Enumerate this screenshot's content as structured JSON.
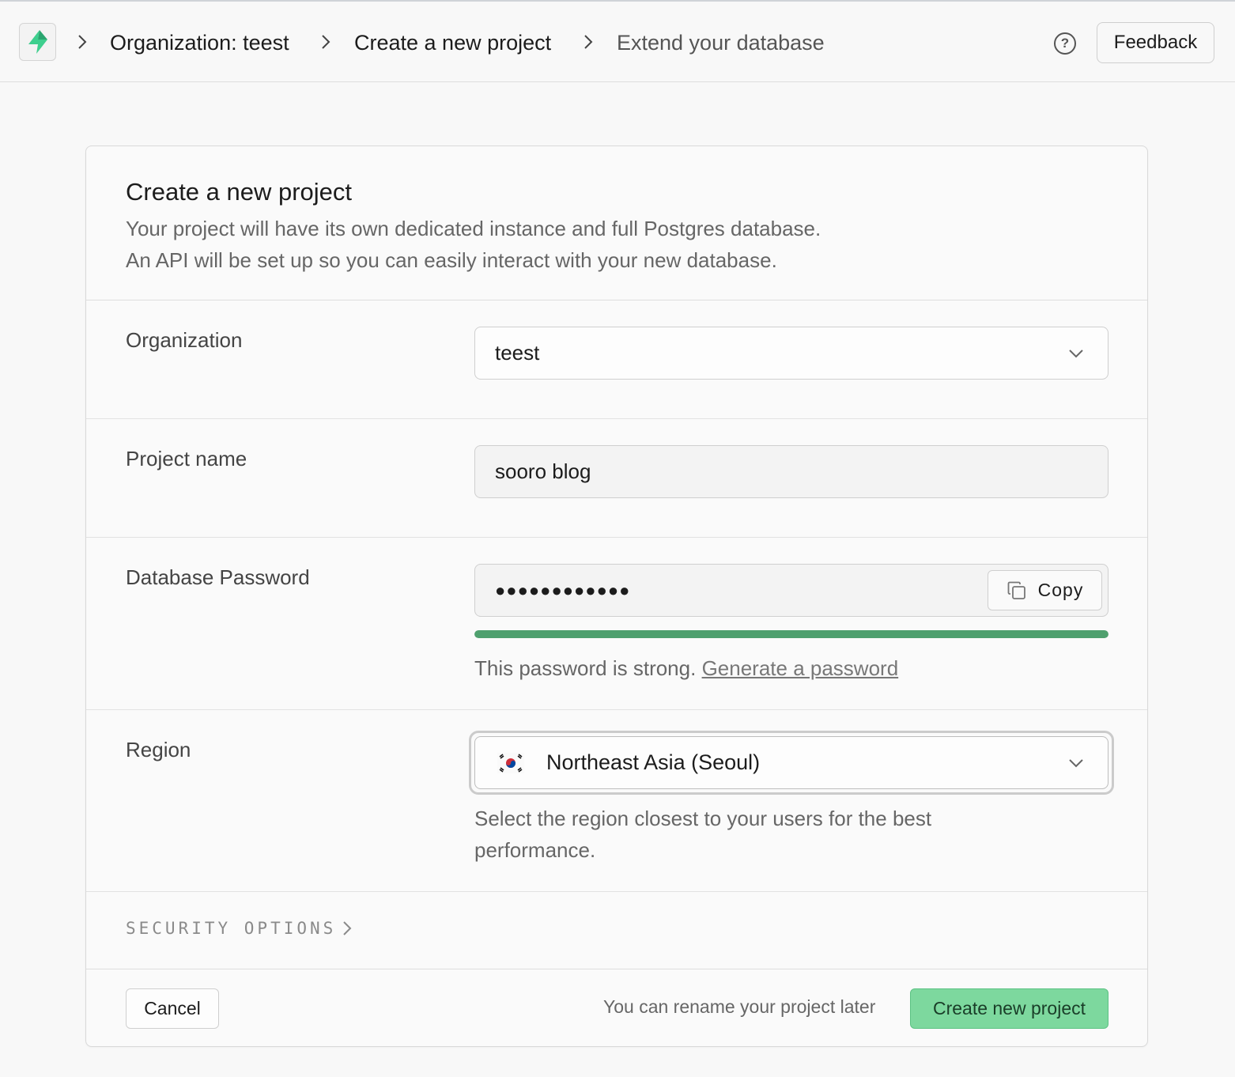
{
  "header": {
    "breadcrumbs": [
      "Organization: teest",
      "Create a new project",
      "Extend your database"
    ],
    "help_icon": "help-circle-icon",
    "feedback_label": "Feedback"
  },
  "card": {
    "title": "Create a new project",
    "description_line1": "Your project will have its own dedicated instance and full Postgres database.",
    "description_line2": "An API will be set up so you can easily interact with your new database."
  },
  "form": {
    "organization": {
      "label": "Organization",
      "value": "teest"
    },
    "project_name": {
      "label": "Project name",
      "value": "sooro blog"
    },
    "password": {
      "label": "Database Password",
      "masked_value": "●●●●●●●●●●●●",
      "copy_label": "Copy",
      "strength_fraction": 1.0,
      "strength_text": "This password is strong.",
      "generate_link": "Generate a password"
    },
    "region": {
      "label": "Region",
      "value": "Northeast Asia (Seoul)",
      "flag_icon": "south-korea-flag-icon",
      "hint": "Select the region closest to your users for the best performance."
    },
    "security_options": "SECURITY OPTIONS"
  },
  "footer": {
    "cancel_label": "Cancel",
    "note": "You can rename your project later",
    "create_label": "Create new project"
  },
  "colors": {
    "brand": "#3ecf8e",
    "strength_bar": "#4fa06e",
    "primary_button": "#7dd89e"
  }
}
